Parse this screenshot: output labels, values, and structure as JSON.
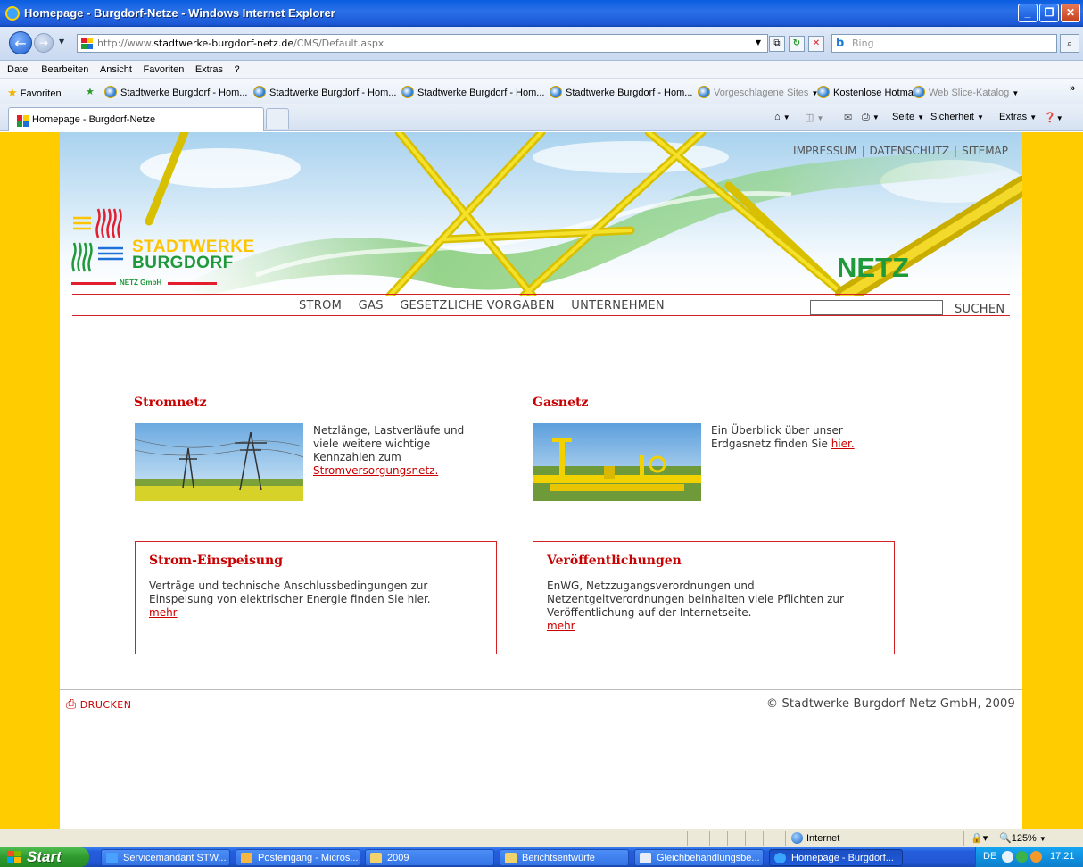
{
  "window": {
    "title": "Homepage - Burgdorf-Netze - Windows Internet Explorer"
  },
  "address": {
    "url_prefix": "http://www.",
    "url_domain": "stadtwerke-burgdorf-netz.de",
    "url_path": "/CMS/Default.aspx",
    "search_placeholder": "Bing"
  },
  "menu": [
    "Datei",
    "Bearbeiten",
    "Ansicht",
    "Favoriten",
    "Extras",
    "?"
  ],
  "favorites": {
    "label": "Favoriten",
    "items": [
      "Stadtwerke Burgdorf - Hom...",
      "Stadtwerke Burgdorf - Hom...",
      "Stadtwerke Burgdorf - Hom...",
      "Stadtwerke Burgdorf - Hom...",
      "Vorgeschlagene Sites",
      "Kostenlose Hotmail",
      "Web Slice-Katalog"
    ]
  },
  "tab": {
    "title": "Homepage - Burgdorf-Netze"
  },
  "commands": {
    "seite": "Seite",
    "sicherheit": "Sicherheit",
    "extras": "Extras"
  },
  "site": {
    "toplinks": [
      "IMPRESSUM",
      "DATENSCHUTZ",
      "SITEMAP"
    ],
    "logo": {
      "line1": "STADTWERKE",
      "line2": "BURGDORF",
      "sub": "NETZ GmbH"
    },
    "netz_label": "NETZ",
    "nav": [
      "STROM",
      "GAS",
      "GESETZLICHE VORGABEN",
      "UNTERNEHMEN"
    ],
    "search_button": "SUCHEN",
    "strom": {
      "title": "Stromnetz",
      "text": "Netzlänge, Lastverläufe und viele weitere wichtige Kennzahlen zum",
      "link": "Stromversorgungsnetz."
    },
    "gas": {
      "title": "Gasnetz",
      "text": "Ein Überblick über unser Erdgasnetz finden Sie",
      "link": "hier."
    },
    "einspeisung": {
      "title": "Strom-Einspeisung",
      "text": "Verträge und technische Anschlussbedingungen zur Einspeisung von elektrischer Energie finden Sie hier.",
      "link": "mehr"
    },
    "veroeffentlichungen": {
      "title": "Veröffentlichungen",
      "text": "EnWG, Netzzugangsverordnungen und Netzentgeltverordnungen beinhalten viele Pflichten zur Veröffentlichung auf der Internetseite.",
      "link": "mehr"
    },
    "print_label": "DRUCKEN",
    "copyright": "© Stadtwerke Burgdorf Netz GmbH, 2009"
  },
  "status": {
    "zone": "Internet",
    "zoom": "125%"
  },
  "taskbar": {
    "start": "Start",
    "items": [
      "Servicemandant STW...",
      "Posteingang - Micros...",
      "2009",
      "Berichtsentwürfe",
      "Gleichbehandlungsbe...",
      "Homepage - Burgdorf..."
    ],
    "lang": "DE",
    "clock": "17:21"
  }
}
